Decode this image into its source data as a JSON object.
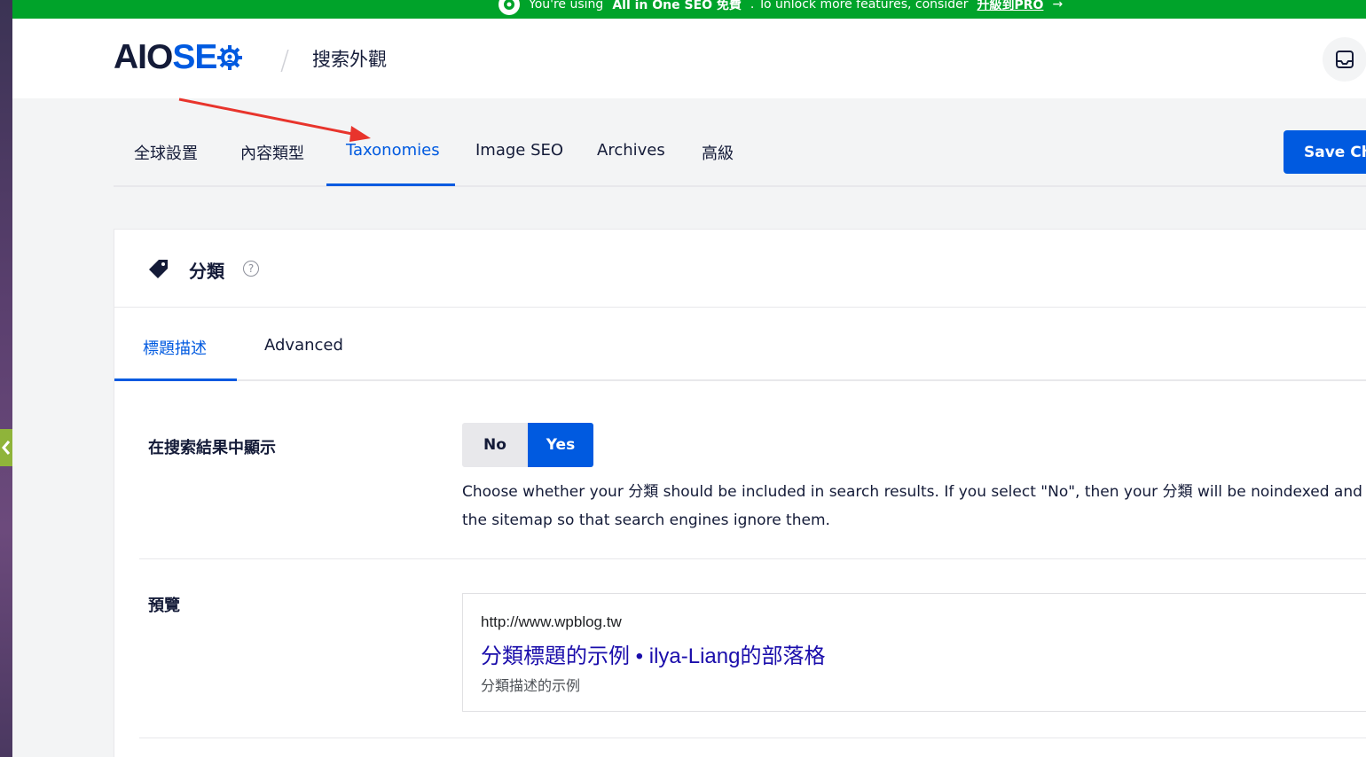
{
  "promo": {
    "text": "You're using",
    "product": "All in One SEO 免費",
    "rest": ". To unlock more features, consider",
    "link": "升級到PRO"
  },
  "header": {
    "logo_aio": "AIO",
    "logo_seo": "SE",
    "separator": "/",
    "title": "搜索外觀"
  },
  "tabs": [
    {
      "label": "全球設置"
    },
    {
      "label": "內容類型"
    },
    {
      "label": "Taxonomies"
    },
    {
      "label": "Image SEO"
    },
    {
      "label": "Archives"
    },
    {
      "label": "高級"
    }
  ],
  "active_tab": "Taxonomies",
  "save_button": "Save Changes",
  "card": {
    "title": "分類",
    "help": "?",
    "subtabs": [
      {
        "label": "標題描述"
      },
      {
        "label": "Advanced"
      }
    ],
    "show_in_search": {
      "label": "在搜索結果中顯示",
      "no": "No",
      "yes": "Yes",
      "selected": "Yes",
      "desc_line1": "Choose whether your 分類 should be included in search results. If you select \"No\", then your 分類 will be noindexed and excluded from",
      "desc_line2": "the sitemap so that search engines ignore them."
    },
    "preview": {
      "label": "預覽",
      "url": "http://www.wpblog.tw",
      "title": "分類標題的示例 • ilya-Liang的部落格",
      "description": "分類描述的示例"
    }
  },
  "colors": {
    "accent": "#005ae0",
    "promo_bg": "#00a32a",
    "annotation_arrow": "#e8342c"
  }
}
